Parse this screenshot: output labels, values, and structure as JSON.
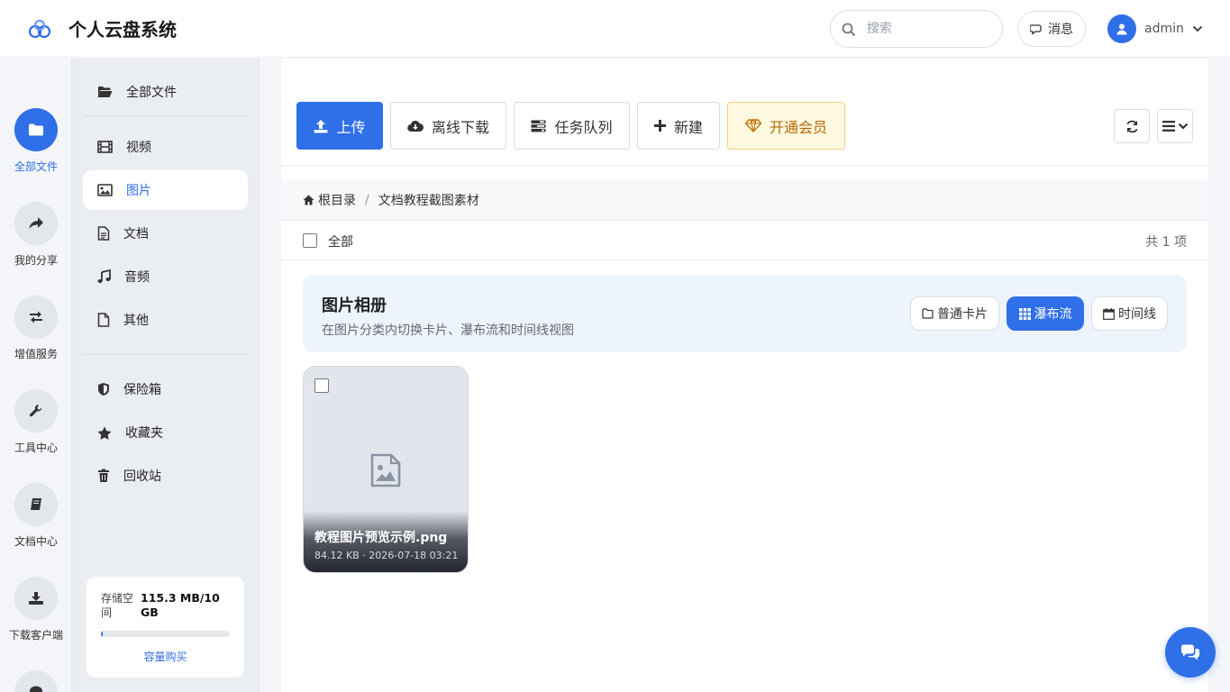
{
  "app": {
    "title": "个人云盘系统",
    "brand_color": "#2f6fe8"
  },
  "header": {
    "search_placeholder": "搜索",
    "messages_label": "消息",
    "username": "admin"
  },
  "rail": {
    "items": [
      {
        "label": "全部文件",
        "icon": "folder-icon",
        "active": true
      },
      {
        "label": "我的分享",
        "icon": "share-icon"
      },
      {
        "label": "增值服务",
        "icon": "exchange-icon"
      },
      {
        "label": "工具中心",
        "icon": "wrench-icon"
      },
      {
        "label": "文档中心",
        "icon": "book-icon"
      },
      {
        "label": "下载客户端",
        "icon": "download-icon"
      }
    ]
  },
  "side": {
    "items": [
      {
        "label": "全部文件",
        "icon": "folder-open-icon"
      },
      {
        "label": "视频",
        "icon": "film-icon"
      },
      {
        "label": "图片",
        "icon": "image-icon",
        "active": true
      },
      {
        "label": "文档",
        "icon": "file-text-icon"
      },
      {
        "label": "音频",
        "icon": "music-icon"
      },
      {
        "label": "其他",
        "icon": "file-icon"
      },
      {
        "label": "保险箱",
        "icon": "shield-icon"
      },
      {
        "label": "收藏夹",
        "icon": "star-icon"
      },
      {
        "label": "回收站",
        "icon": "trash-icon"
      }
    ],
    "storage": {
      "label": "存储空间",
      "value": "115.3 MB/10 GB",
      "used_fraction": 0.011,
      "link": "容量购买"
    }
  },
  "toolbar": {
    "upload": "上传",
    "offline_download": "离线下载",
    "task_queue": "任务队列",
    "new": "新建",
    "vip": "开通会员"
  },
  "breadcrumb": {
    "root": "根目录",
    "current": "文档教程截图素材"
  },
  "list": {
    "select_all": "全部",
    "count": "共 1 项"
  },
  "album": {
    "title": "图片相册",
    "subtitle": "在图片分类内切换卡片、瀑布流和时间线视图",
    "views": [
      "普通卡片",
      "瀑布流",
      "时间线"
    ],
    "active_view": "瀑布流"
  },
  "files": [
    {
      "name": "教程图片预览示例.png",
      "meta": "84.12 KB · 2026-07-18 03:21"
    }
  ]
}
